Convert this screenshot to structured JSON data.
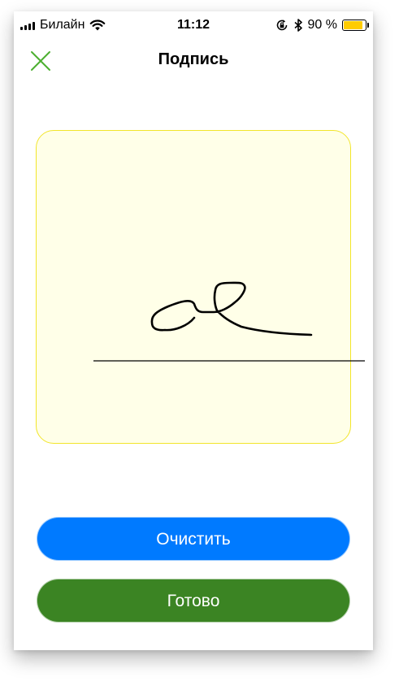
{
  "status_bar": {
    "carrier": "Билайн",
    "time": "11:12",
    "battery_percent": "90 %",
    "battery_level": 0.9,
    "icons": [
      "signal-icon",
      "wifi-icon",
      "orientation-lock-icon",
      "bluetooth-icon",
      "battery-icon"
    ]
  },
  "nav": {
    "title": "Подпись",
    "close_icon": "close-icon"
  },
  "signature_pad": {
    "has_signature": true,
    "background": "#ffffe8",
    "border_color": "#f2e52a"
  },
  "buttons": {
    "clear_label": "Очистить",
    "done_label": "Готово"
  },
  "colors": {
    "accent_green": "#3b8423",
    "close_green": "#4caf2f",
    "blue": "#007aff",
    "battery_yellow": "#ffcc00"
  }
}
